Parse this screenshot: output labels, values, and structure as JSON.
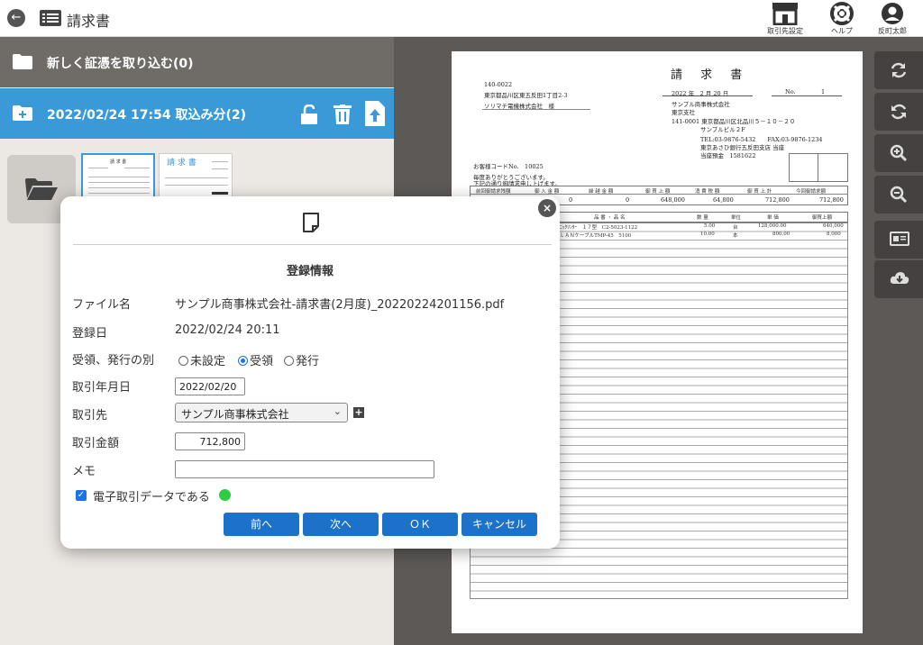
{
  "header": {
    "title": "請求書",
    "actions": [
      {
        "label": "取引先設定",
        "icon": "shop-icon"
      },
      {
        "label": "ヘルプ",
        "icon": "lifebuoy-icon"
      },
      {
        "label": "反町太郎",
        "icon": "user-avatar-icon"
      }
    ]
  },
  "left_panel": {
    "import_new": "新しく証憑を取り込む(0)",
    "import_batch": "2022/02/24 17:54 取込み分(2)"
  },
  "document": {
    "title": "請 求 書",
    "zip": "140-0022",
    "address": "東京都品川区東五反田1丁目2-3",
    "recipient": "ソリマチ電機株式会社　様",
    "date": "2022 年　2 月 20 日",
    "no_label": "No.",
    "no_value": "1",
    "issuer_name": "サンプル商事株式会社",
    "issuer_branch": "東京支社",
    "issuer_addr": "141-0001  東京都品川区北品川５－１０－２０",
    "issuer_bldg": "サンプルビル２F",
    "issuer_tel": "TEL:03-9876-5432　　FAX:03-9876-1234",
    "issuer_bank": "東京あさひ銀行五反田支店 当座",
    "issuer_acct": "当座預金　1581622",
    "customer_code": "お客様コードNo.　10025",
    "greeting1": "毎度ありがとうございます。",
    "greeting2": "下記の通り御請求申し上げます。",
    "summary_headers": [
      "前回御請求残額",
      "御 入 金 額",
      "繰 越 金 額",
      "御 買 上 額",
      "消 費 税 額",
      "御 買 上 計",
      "今回御請求額"
    ],
    "summary_values": [
      "",
      "0",
      "0",
      "648,000",
      "64,800",
      "712,800",
      "712,800"
    ],
    "item_headers": [
      "品 番 ・ 品 名",
      "数 量",
      "単位",
      "単 価",
      "御買上額"
    ],
    "items": [
      {
        "name": "ﾆｯｸﾘﾝﾀｰ　１７型　C2-5023-1122",
        "qty": "5.00",
        "unit": "台",
        "price": "128,000.00",
        "amount": "640,000"
      },
      {
        "name": "ＬＡＮケーブルTMP-45　5100",
        "qty": "10.00",
        "unit": "本",
        "price": "800.00",
        "amount": "8,000"
      }
    ]
  },
  "dialog": {
    "title": "登録情報",
    "file_label": "ファイル名",
    "file_value": "サンプル商事株式会社-請求書(2月度)_20220224201156.pdf",
    "reg_date_label": "登録日",
    "reg_date_value": "2022/02/24 20:11",
    "type_label": "受領、発行の別",
    "type_options": [
      "未設定",
      "受領",
      "発行"
    ],
    "type_selected": "受領",
    "trade_date_label": "取引年月日",
    "trade_date_value": "2022/02/20",
    "partner_label": "取引先",
    "partner_value": "サンプル商事株式会社",
    "amount_label": "取引金額",
    "amount_value": "712,800",
    "memo_label": "メモ",
    "memo_value": "",
    "edoc_label": "電子取引データである",
    "edoc_checked": true,
    "buttons": {
      "prev": "前へ",
      "next": "次へ",
      "ok": "ＯＫ",
      "cancel": "キャンセル"
    }
  },
  "colors": {
    "accent_blue": "#3a9ad8",
    "button_blue": "#1c72c8",
    "status_green": "#2ecc40",
    "viewer_bg": "#5c5957"
  }
}
